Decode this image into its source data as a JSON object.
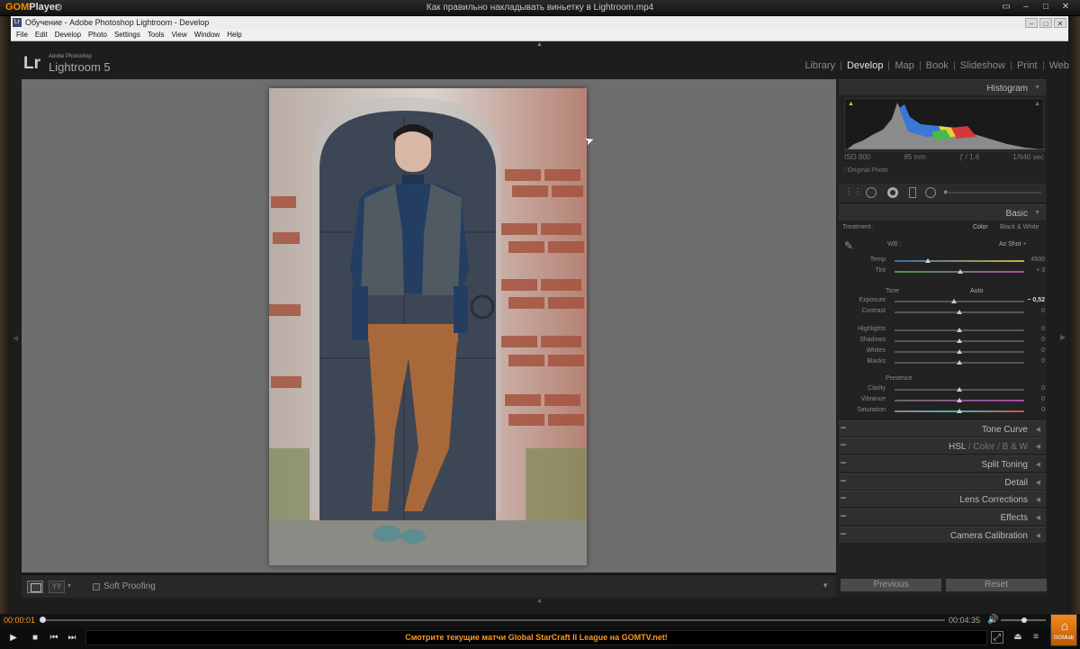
{
  "player": {
    "brand_prefix": "GOM",
    "brand_suffix": "Player",
    "video_title": "Как правильно накладывать виньетку в Lightroom.mp4",
    "time_current": "00:00:01",
    "time_total": "00:04:35",
    "ticker": "Смотрите текущие матчи Global StarCraft II League на GOMTV.net!",
    "gomlab_label": "GOMlab",
    "accent_color": "#ff9a1e"
  },
  "lightroom": {
    "window_title": "Обучение - Adobe Photoshop Lightroom - Develop",
    "menu": [
      "File",
      "Edit",
      "Develop",
      "Photo",
      "Settings",
      "Tools",
      "View",
      "Window",
      "Help"
    ],
    "logo": "Lr",
    "adobe_label": "Adobe Photoshop",
    "product": "Lightroom 5",
    "modules": [
      {
        "label": "Library",
        "active": false
      },
      {
        "label": "Develop",
        "active": true
      },
      {
        "label": "Map",
        "active": false
      },
      {
        "label": "Book",
        "active": false
      },
      {
        "label": "Slideshow",
        "active": false
      },
      {
        "label": "Print",
        "active": false
      },
      {
        "label": "Web",
        "active": false
      }
    ]
  },
  "toolbar": {
    "soft_proofing": "Soft Proofing"
  },
  "histogram": {
    "title": "Histogram",
    "iso": "ISO 800",
    "focal": "85 mm",
    "aperture": "ƒ / 1.6",
    "shutter": "1/640 sec",
    "original_photo": "Original Photo"
  },
  "basic": {
    "title": "Basic",
    "treatment_label": "Treatment :",
    "color": "Color",
    "bw": "Black & White",
    "wb_label": "WB :",
    "wb_value": "As Shot ÷",
    "tone_label": "Tone",
    "auto_label": "Auto",
    "presence_label": "Presence",
    "sliders": [
      {
        "name": "temp",
        "label": "Temp",
        "value": "4500",
        "position": 0.26
      },
      {
        "name": "tint",
        "label": "Tint",
        "value": "+ 3",
        "position": 0.51
      },
      {
        "name": "exposure",
        "label": "Exposure",
        "value": "− 0,52",
        "position": 0.46
      },
      {
        "name": "contrast",
        "label": "Contrast",
        "value": "0",
        "position": 0.5
      },
      {
        "name": "highlights",
        "label": "Highlights",
        "value": "0",
        "position": 0.5
      },
      {
        "name": "shadows",
        "label": "Shadows",
        "value": "0",
        "position": 0.5
      },
      {
        "name": "whites",
        "label": "Whites",
        "value": "0",
        "position": 0.5
      },
      {
        "name": "blacks",
        "label": "Blacks",
        "value": "0",
        "position": 0.5
      },
      {
        "name": "clarity",
        "label": "Clarity",
        "value": "0",
        "position": 0.5
      },
      {
        "name": "vibrance",
        "label": "Vibrance",
        "value": "0",
        "position": 0.5
      },
      {
        "name": "saturation",
        "label": "Saturation",
        "value": "0",
        "position": 0.5
      }
    ]
  },
  "panels": {
    "tone_curve": "Tone Curve",
    "hsl": "HSL",
    "color": "Color",
    "bw": "B & W",
    "split_toning": "Split Toning",
    "detail": "Detail",
    "lens_corrections": "Lens Corrections",
    "effects": "Effects",
    "camera_calibration": "Camera Calibration"
  },
  "buttons": {
    "previous": "Previous",
    "reset": "Reset"
  }
}
